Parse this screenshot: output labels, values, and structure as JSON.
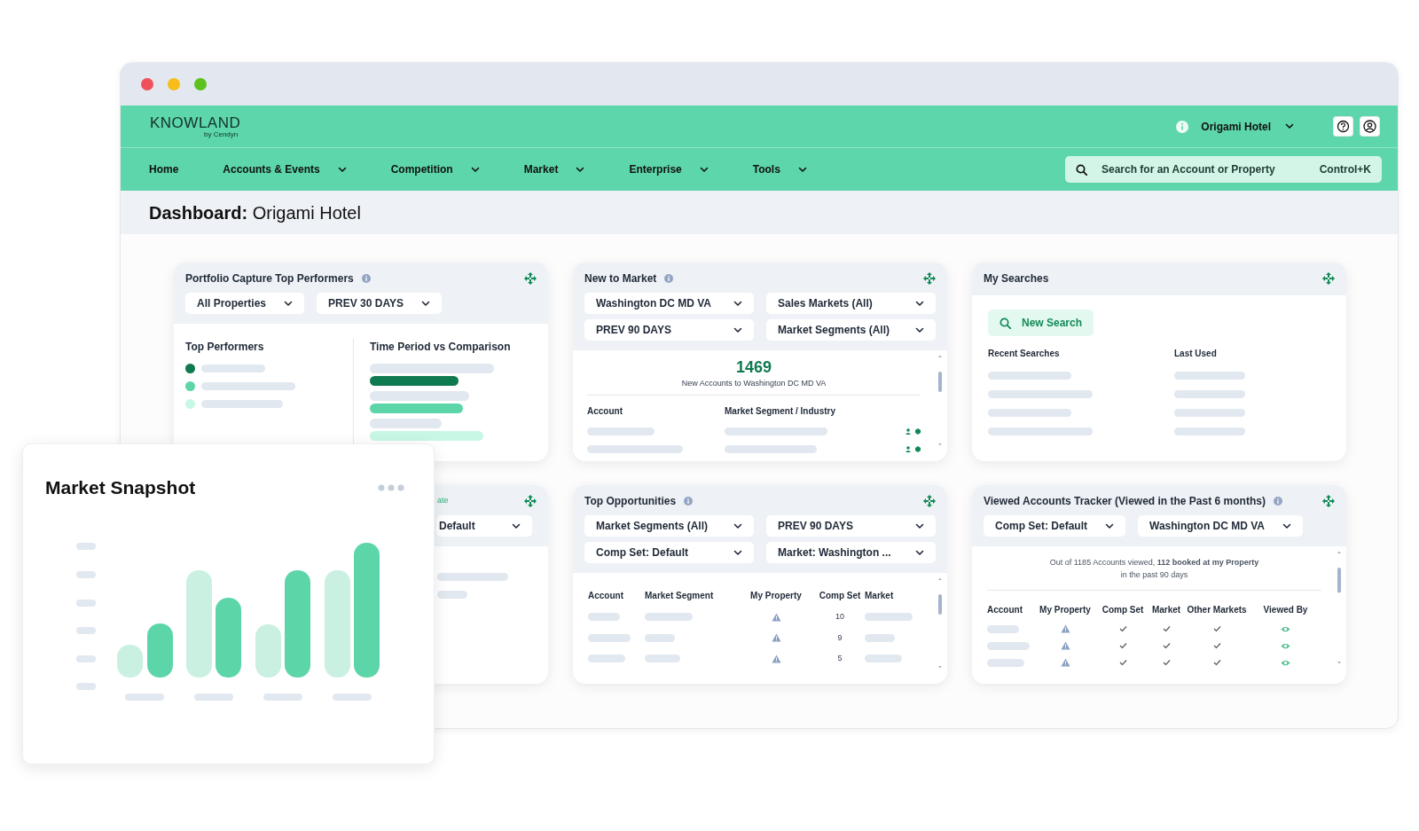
{
  "header": {
    "logo": "KNOWLAND",
    "logo_tagline": "by Cendyn",
    "property": "Origami Hotel"
  },
  "nav": [
    {
      "label": "Home",
      "has_menu": false
    },
    {
      "label": "Accounts & Events",
      "has_menu": true
    },
    {
      "label": "Competition",
      "has_menu": true
    },
    {
      "label": "Market",
      "has_menu": true
    },
    {
      "label": "Enterprise",
      "has_menu": true
    },
    {
      "label": "Tools",
      "has_menu": true
    }
  ],
  "search": {
    "placeholder": "Search for an Account or Property",
    "shortcut": "Control+K"
  },
  "page_title": "**Dashboard:** Origami Hotel",
  "cards": [
    {
      "kind": "portfolio",
      "title": "Portfolio Capture Top Performers",
      "info": true,
      "filters": [
        "All Properties",
        "PREV 30 DAYS"
      ],
      "left_heading": "Top Performers",
      "right_heading": "Time Period vs Comparison",
      "top_performers": [
        {
          "color": "#0f7a4f"
        },
        {
          "color": "#5cd6a9"
        },
        {
          "color": "#c9f7e5"
        }
      ]
    },
    {
      "kind": "new_to_market",
      "title": "New to Market",
      "info": true,
      "filters": [
        "Washington DC MD VA",
        "Sales Markets (All)",
        "PREV 90 DAYS",
        "Market Segments (All)"
      ],
      "total": "1469",
      "caption": "New Accounts to Washington DC MD VA",
      "columns": [
        "Account",
        "Market Segment / Industry"
      ]
    },
    {
      "kind": "searches",
      "title": "My Searches",
      "info": false,
      "button": "New Search",
      "columns": [
        "Recent Searches",
        "Last Used"
      ]
    },
    {
      "kind": "partial",
      "fragment": "ate",
      "filters": [
        "Default"
      ]
    },
    {
      "kind": "opportunities",
      "title": "Top Opportunities",
      "info": true,
      "filters": [
        "Market Segments (All)",
        "PREV 90 DAYS",
        "Comp Set: Default",
        "Market: Washington ..."
      ],
      "columns": [
        "Account",
        "Market Segment",
        "My Property",
        "Comp Set",
        "Market"
      ],
      "comp_set_values": [
        "10",
        "9",
        "5"
      ]
    },
    {
      "kind": "tracker",
      "title": "Viewed Accounts Tracker (Viewed in the Past 6 months)",
      "info": true,
      "filters": [
        "Comp Set: Default",
        "Washington DC MD VA"
      ],
      "summary": "Out of 1185 Accounts viewed, **112 booked at my Property**",
      "summary_line_2": "in the past 90 days",
      "columns": [
        "Account",
        "My Property",
        "Comp Set",
        "Market",
        "Other Markets",
        "Viewed By"
      ]
    }
  ],
  "snapshot": {
    "title": "Market Snapshot"
  }
}
